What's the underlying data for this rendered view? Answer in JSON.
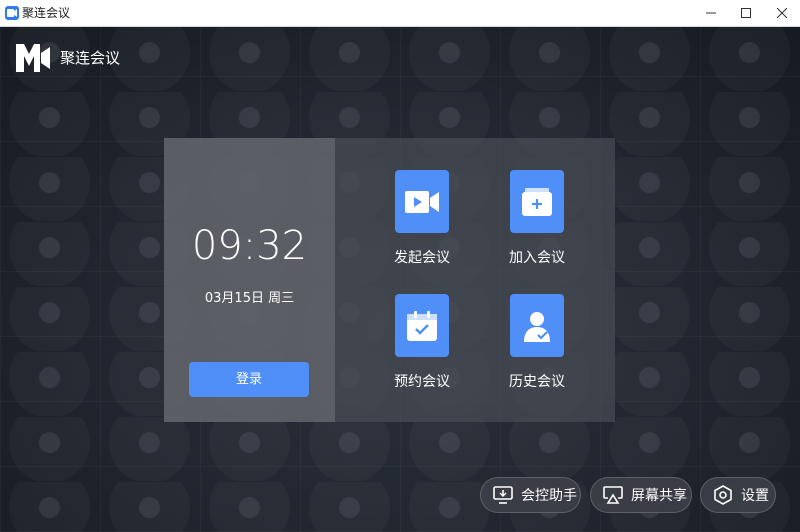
{
  "window": {
    "title": "聚连会议"
  },
  "brand": {
    "name": "聚连会议"
  },
  "clock": {
    "time": "09:32",
    "date": "03月15日  周三"
  },
  "login": {
    "label": "登录"
  },
  "actions": [
    {
      "label": "发起会议",
      "icon": "video-camera-icon"
    },
    {
      "label": "加入会议",
      "icon": "join-meeting-icon"
    },
    {
      "label": "预约会议",
      "icon": "calendar-check-icon"
    },
    {
      "label": "历史会议",
      "icon": "user-history-icon"
    }
  ],
  "bottom_bar": [
    {
      "label": "会控助手",
      "icon": "monitor-icon"
    },
    {
      "label": "屏幕共享",
      "icon": "screen-share-icon"
    },
    {
      "label": "设置",
      "icon": "settings-icon"
    }
  ],
  "colors": {
    "accent": "#4f8ff7",
    "title_bar": "#ffffff",
    "background": "#1d222b"
  }
}
